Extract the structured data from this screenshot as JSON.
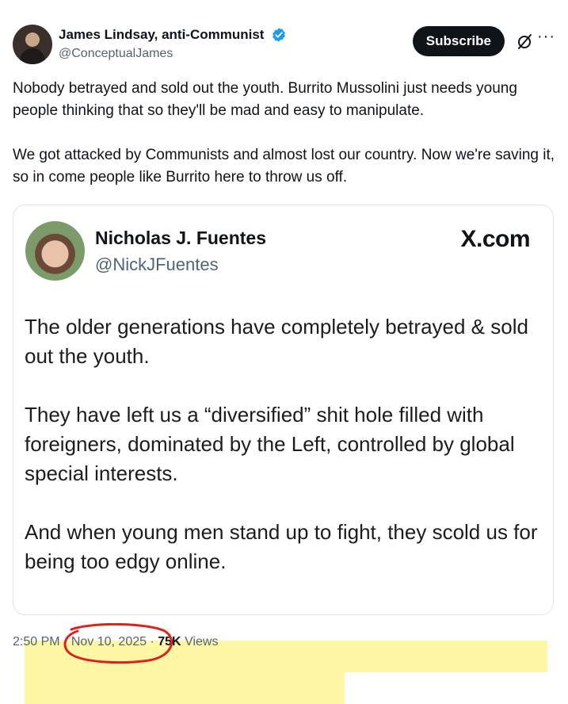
{
  "author": {
    "name": "James Lindsay, anti-Communist",
    "handle": "@ConceptualJames"
  },
  "actions": {
    "subscribe_label": "Subscribe",
    "grok_icon": "slashed-circle-icon",
    "more_icon": "more-icon",
    "more_label": "···"
  },
  "post": {
    "paragraphs": [
      "Nobody betrayed and sold out the youth. Burrito Mussolini just needs young people thinking that so they'll be mad and easy to manipulate.",
      "We got attacked by Communists and almost lost our country. Now we're saving it, so in come people like Burrito here to throw us off."
    ]
  },
  "quote": {
    "name": "Nicholas J. Fuentes",
    "handle": "@NickJFuentes",
    "brand": "X.com",
    "paragraphs": [
      "The older generations have completely betrayed & sold out the youth.",
      "They have left us a “diversified” shit hole filled with foreigners, dominated by the Left, controlled by global special interests.",
      "And when young men stand up to fight, they scold us for being too edgy online."
    ],
    "highlight_color": "#fdf7a6"
  },
  "meta": {
    "time": "2:50 PM",
    "separator": "·",
    "date": "Nov 10, 2025",
    "views_count": "75K",
    "views_label": "Views"
  },
  "colors": {
    "accent": "#1d9bf0",
    "annotation": "#e0201b"
  }
}
